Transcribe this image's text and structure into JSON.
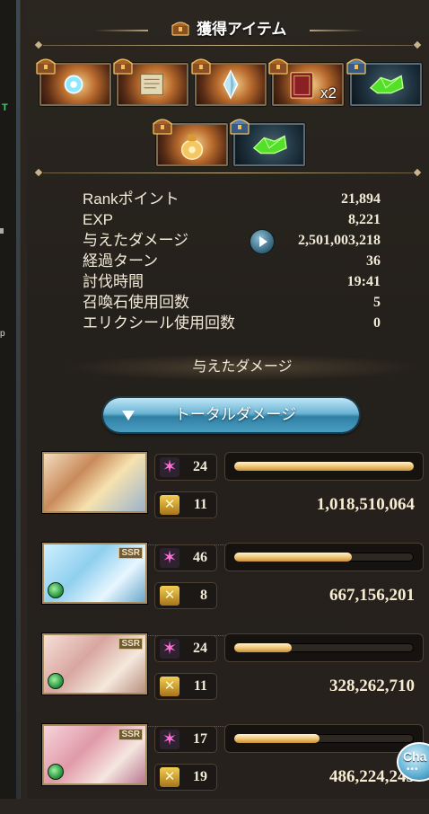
{
  "header": {
    "title": "獲得アイテム"
  },
  "items_row1": [
    {
      "kind": "blue-orb-icon",
      "style": "gold",
      "qty": ""
    },
    {
      "kind": "scroll-icon",
      "style": "gold",
      "qty": ""
    },
    {
      "kind": "crystal-icon",
      "style": "gold",
      "qty": ""
    },
    {
      "kind": "book-icon",
      "style": "gold",
      "qty": "x2"
    },
    {
      "kind": "green-gem-icon",
      "style": "blue",
      "qty": ""
    }
  ],
  "items_row2": [
    {
      "kind": "coin-pouch-icon",
      "style": "gold",
      "qty": ""
    },
    {
      "kind": "green-gem-icon",
      "style": "blue",
      "qty": ""
    }
  ],
  "stats": [
    {
      "label": "Rankポイント",
      "value": "21,894"
    },
    {
      "label": "EXP",
      "value": "8,221"
    },
    {
      "label": "与えたダメージ",
      "value": "2,501,003,218"
    },
    {
      "label": "経過ターン",
      "value": "36"
    },
    {
      "label": "討伐時間",
      "value": "19:41"
    },
    {
      "label": "召喚石使用回数",
      "value": "5"
    },
    {
      "label": "エリクシール使用回数",
      "value": "0"
    }
  ],
  "damage_section": {
    "label": "与えたダメージ"
  },
  "total_button": {
    "label": "トータルダメージ"
  },
  "characters": [
    {
      "hits": "24",
      "turns": "11",
      "damage": "1,018,510,064",
      "share": 1.0,
      "ssr": "",
      "element": ""
    },
    {
      "hits": "46",
      "turns": "8",
      "damage": "667,156,201",
      "share": 0.655,
      "ssr": "SSR",
      "element": "wind"
    },
    {
      "hits": "24",
      "turns": "11",
      "damage": "328,262,710",
      "share": 0.322,
      "ssr": "SSR",
      "element": "wind"
    },
    {
      "hits": "17",
      "turns": "19",
      "damage": "486,224,243",
      "share": 0.477,
      "ssr": "SSR",
      "element": "wind"
    }
  ],
  "sidebar": {
    "text1": "T",
    "text2": "p"
  },
  "chat_button": {
    "label": "Cha",
    "dots": "•••"
  },
  "colors": {
    "accent_blue": "#6ab3d4",
    "bar_gold": "#f0c878",
    "hits_pink": "#ff6fd7"
  }
}
